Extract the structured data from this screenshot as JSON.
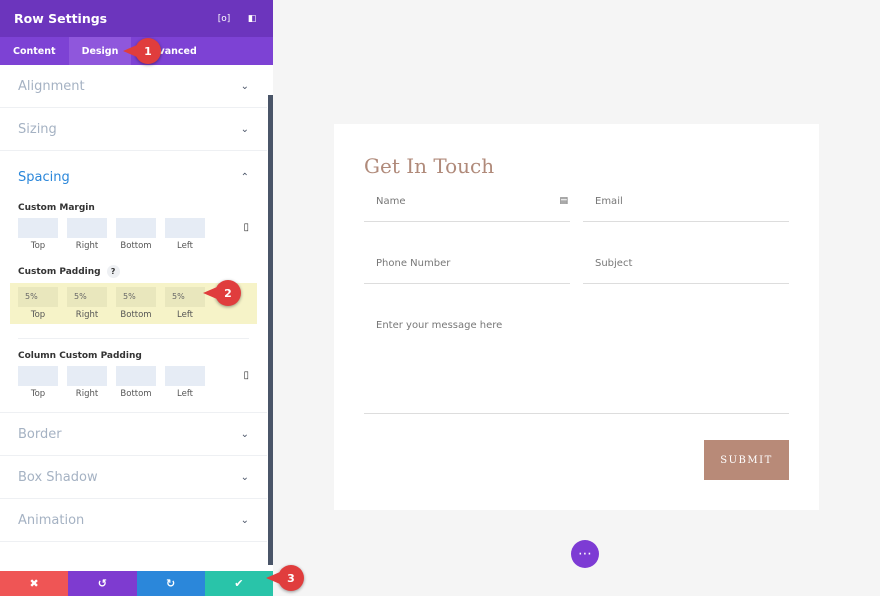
{
  "panel": {
    "title": "Row Settings",
    "tabs": [
      "Content",
      "Design",
      "Advanced"
    ],
    "sections": {
      "alignment": "Alignment",
      "sizing": "Sizing",
      "spacing": "Spacing",
      "border": "Border",
      "box_shadow": "Box Shadow",
      "animation": "Animation"
    },
    "custom_margin": {
      "label": "Custom Margin",
      "values": [
        "",
        "",
        "",
        ""
      ]
    },
    "custom_padding": {
      "label": "Custom Padding",
      "help": "?",
      "values": [
        "5%",
        "5%",
        "5%",
        "5%"
      ]
    },
    "column_padding": {
      "label": "Column Custom Padding",
      "values": [
        "",
        "",
        "",
        ""
      ]
    },
    "captions": [
      "Top",
      "Right",
      "Bottom",
      "Left"
    ]
  },
  "footer": {
    "cancel": "✖",
    "undo": "↺",
    "redo": "↻",
    "save": "✔"
  },
  "badges": [
    "1",
    "2",
    "3"
  ],
  "form": {
    "title": "Get In Touch",
    "name": "Name",
    "email": "Email",
    "phone": "Phone Number",
    "subject": "Subject",
    "message": "Enter your message here",
    "submit": "SUBMIT"
  },
  "colors": {
    "header": "#6c35bd",
    "accent": "#2b87da",
    "brand": "#b88a78"
  }
}
